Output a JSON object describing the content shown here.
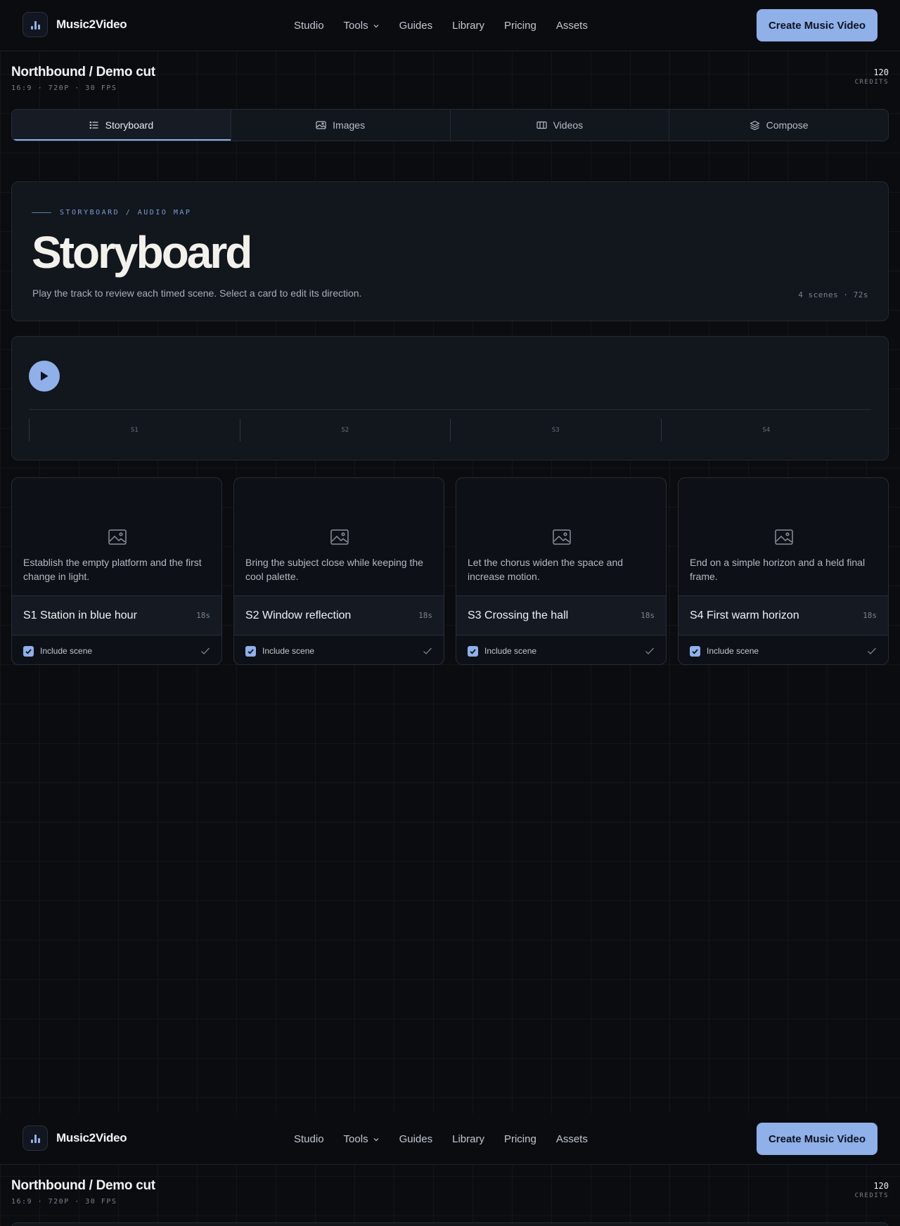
{
  "nav": {
    "brand": "Music2Video",
    "links": [
      "Studio",
      "Tools",
      "Guides",
      "Library",
      "Pricing",
      "Assets"
    ],
    "cta": "Create Music Video"
  },
  "project": {
    "title": "Northbound / Demo cut",
    "meta": "16:9 · 720P · 30 FPS",
    "credits_value": "120",
    "credits_label": "CREDITS"
  },
  "tabs": [
    {
      "label": "Storyboard",
      "icon": "list-icon",
      "active": true
    },
    {
      "label": "Images",
      "icon": "image-icon",
      "active": false
    },
    {
      "label": "Videos",
      "icon": "film-icon",
      "active": false
    },
    {
      "label": "Compose",
      "icon": "layers-icon",
      "active": false
    }
  ],
  "hero": {
    "eyebrow": "STORYBOARD / AUDIO MAP",
    "title": "Storyboard",
    "description": "Play the track to review each timed scene. Select a card to edit its direction.",
    "stats": "4 scenes · 72s"
  },
  "audio": {
    "segments": [
      "S1",
      "S2",
      "S3",
      "S4"
    ]
  },
  "scenes": [
    {
      "title": "S1 Station in blue hour",
      "duration": "18s",
      "description": "Establish the empty platform and the first change in light.",
      "include_label": "Include scene",
      "included": true
    },
    {
      "title": "S2 Window reflection",
      "duration": "18s",
      "description": "Bring the subject close while keeping the cool palette.",
      "include_label": "Include scene",
      "included": true
    },
    {
      "title": "S3 Crossing the hall",
      "duration": "18s",
      "description": "Let the chorus widen the space and increase motion.",
      "include_label": "Include scene",
      "included": true
    },
    {
      "title": "S4 First warm horizon",
      "duration": "18s",
      "description": "End on a simple horizon and a held final frame.",
      "include_label": "Include scene",
      "included": true
    }
  ],
  "colors": {
    "accent": "#8fb0e8",
    "background": "#0a0c10",
    "panel": "#12161d"
  }
}
